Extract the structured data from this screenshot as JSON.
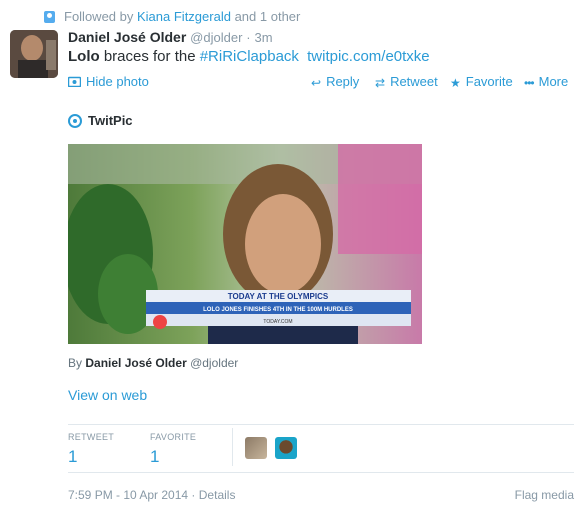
{
  "context": {
    "prefix": "Followed by",
    "follower": "Kiana Fitzgerald",
    "suffix": "and 1 other"
  },
  "tweet": {
    "fullname": "Daniel José Older",
    "handle": "@djolder",
    "time": "3m",
    "text_bold": "Lolo",
    "text_plain": "braces for the",
    "hashtag": "#RiRiClapback",
    "link": "twitpic.com/e0txke"
  },
  "actions": {
    "hide_photo": "Hide photo",
    "reply": "Reply",
    "retweet": "Retweet",
    "favorite": "Favorite",
    "more": "More"
  },
  "card": {
    "provider": "TwitPic",
    "photo_banner": "TODAY AT THE OLYMPICS",
    "photo_subtitle": "LOLO JONES FINISHES 4TH IN THE 100M HURDLES",
    "photo_url": "TODAY.COM",
    "by_prefix": "By",
    "by_name": "Daniel José Older",
    "by_handle": "@djolder",
    "view_on_web": "View on web"
  },
  "stats": {
    "retweet_label": "RETWEET",
    "retweet_count": "1",
    "favorite_label": "FAVORITE",
    "favorite_count": "1"
  },
  "footer": {
    "timestamp": "7:59 PM - 10 Apr 2014",
    "separator": "·",
    "details": "Details",
    "flag": "Flag media"
  },
  "colors": {
    "link": "#2b9bd6",
    "muted": "#8899a6",
    "text": "#292f33"
  }
}
